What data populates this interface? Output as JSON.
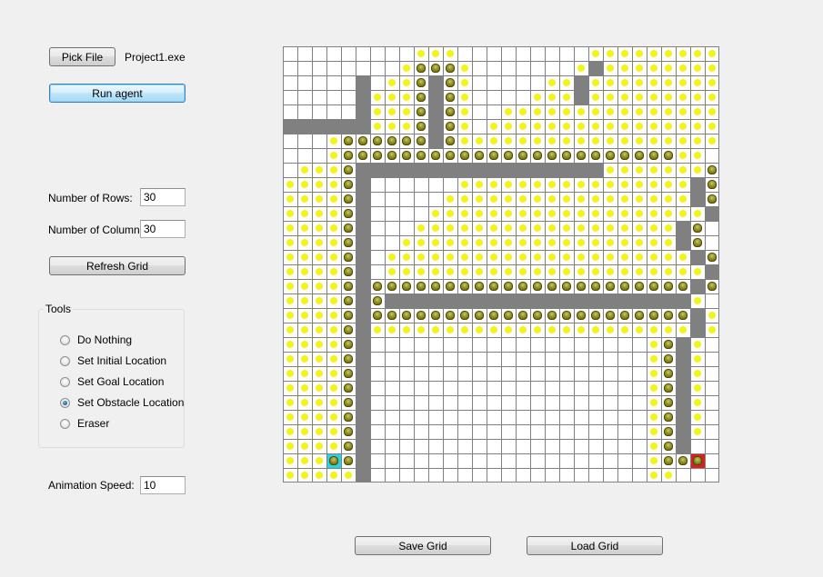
{
  "controls": {
    "pick_file_label": "Pick File",
    "selected_file": "Project1.exe",
    "run_agent_label": "Run agent",
    "rows_label": "Number of Rows:",
    "rows_value": "30",
    "columns_label": "Number of Columns:",
    "columns_value": "30",
    "refresh_label": "Refresh Grid",
    "speed_label": "Animation Speed:",
    "speed_value": "10",
    "save_label": "Save Grid",
    "load_label": "Load Grid"
  },
  "tools": {
    "title": "Tools",
    "options": [
      {
        "label": "Do Nothing",
        "checked": false
      },
      {
        "label": "Set Initial Location",
        "checked": false
      },
      {
        "label": "Set Goal Location",
        "checked": false
      },
      {
        "label": "Set Obstacle Location",
        "checked": true
      },
      {
        "label": "Eraser",
        "checked": false
      }
    ]
  },
  "grid": {
    "rows": 30,
    "cols": 30,
    "legend": {
      ".": "empty",
      "#": "obstacle",
      "o": "food",
      "a": "agent-trail",
      "S": "initial-location",
      "G": "goal-location"
    },
    "cells": [
      ".........ooo.........oooooooooo",
      "........oaaao.......o#oooooooo",
      ".....#.ooa#ao.....oo#ooooooooo",
      ".....#oooa#ao....ooo#ooooooooo",
      ".....#oooa#ao..oooooooooooooooo",
      "######oooa#ao.ooooooooooooooooo",
      "...oaaaaaa#aoooooooooooooooooo",
      "...oaaaaaaaaaaaaaaaaaaaaaaaoo..",
      ".oooa#################oooooooa",
      "ooooa#......oooooooooooooooo#a",
      "ooooa#.....ooooooooooooooooo#a",
      "ooooa#....ooooooooooooooooooo#a",
      "ooooa#...oooooooooooooooooo#a",
      "ooooa#..ooooooooooooooooooo#a",
      "ooooa#.ooooooooooooooooooooo#a",
      "ooooa#.oooooooooooooooooooooo#a",
      "ooooa#aaaaaaaaaaaaaaaaaaaaaa#a",
      "ooooa#a#####################o",
      "ooooa#aaaaaaaaaaaaaaaaaaaaaa#o",
      "ooooa#oooooooooooooooooooooo#o",
      "ooooa#...................oa#o",
      "ooooa#...................oa#o",
      "ooooa#...................oa#o",
      "ooooa#...................oa#o",
      "ooooa#...................oa#o",
      "ooooa#...................oa#o",
      "ooooa#...................oa#o",
      "ooooa#...................oa#.",
      "oooSa#...................oaaG",
      "ooooo#...................oo.."
    ]
  }
}
